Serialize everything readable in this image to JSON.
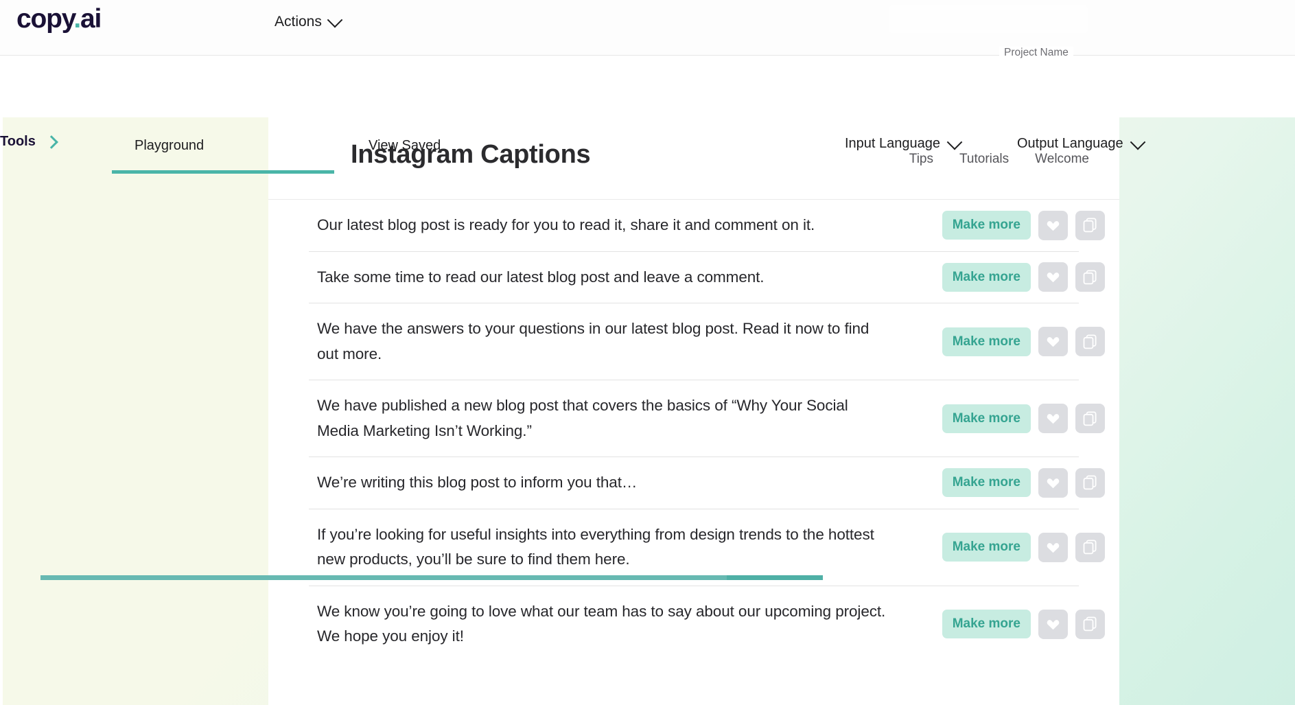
{
  "brand": {
    "logo_main": "copy",
    "logo_dot": ".",
    "logo_suffix": "ai"
  },
  "topbar": {
    "actions_label": "Actions",
    "actions_icon": "chevron-down-icon",
    "project_name": "Project Name"
  },
  "navbar": {
    "tools_label": "Tools",
    "tools_icon": "chevron-right-icon",
    "tabs": [
      {
        "label": "Playground",
        "active": true
      },
      {
        "label": "View Saved",
        "active": false
      }
    ],
    "input_language_label": "Input Language",
    "output_language_label": "Output Language",
    "dropdown_icon": "chevron-down-icon",
    "active_tab_color": "#4ab5a8"
  },
  "card": {
    "title": "Instagram Captions",
    "links": [
      {
        "label": "Tips"
      },
      {
        "label": "Tutorials"
      },
      {
        "label": "Welcome"
      }
    ],
    "row_actions": {
      "make_more_label": "Make more",
      "favorite_icon": "heart-icon",
      "copy_icon": "copy-icon",
      "make_more_bg": "#c7ece1",
      "make_more_text_color": "#35a491",
      "icon_btn_bg": "#dcdde1"
    },
    "results": [
      {
        "text": "Our latest blog post is ready for you to read it, share it and comment on it."
      },
      {
        "text": "Take some time to read our latest blog post and leave a comment."
      },
      {
        "text": "We have the answers to your questions in our latest blog post. Read it now to find out more."
      },
      {
        "text": "We have published a new blog post that covers the basics of “Why Your Social Media Marketing Isn’t Working.”"
      },
      {
        "text": "We’re writing this blog post to inform you that…"
      },
      {
        "text": "If you’re looking for useful insights into everything from design trends to the hottest new products, you’ll be sure to find them here."
      },
      {
        "text": "We know you’re going to love what our team has to say about our upcoming project. We hope you enjoy it!"
      }
    ]
  },
  "colors": {
    "accent_teal": "#4ab5a8",
    "logo_navy": "#1a1136",
    "page_bg_left": "#f6f9e9",
    "page_bg_right": "#cfefe3",
    "bottom_bar": "#67b9b2"
  }
}
